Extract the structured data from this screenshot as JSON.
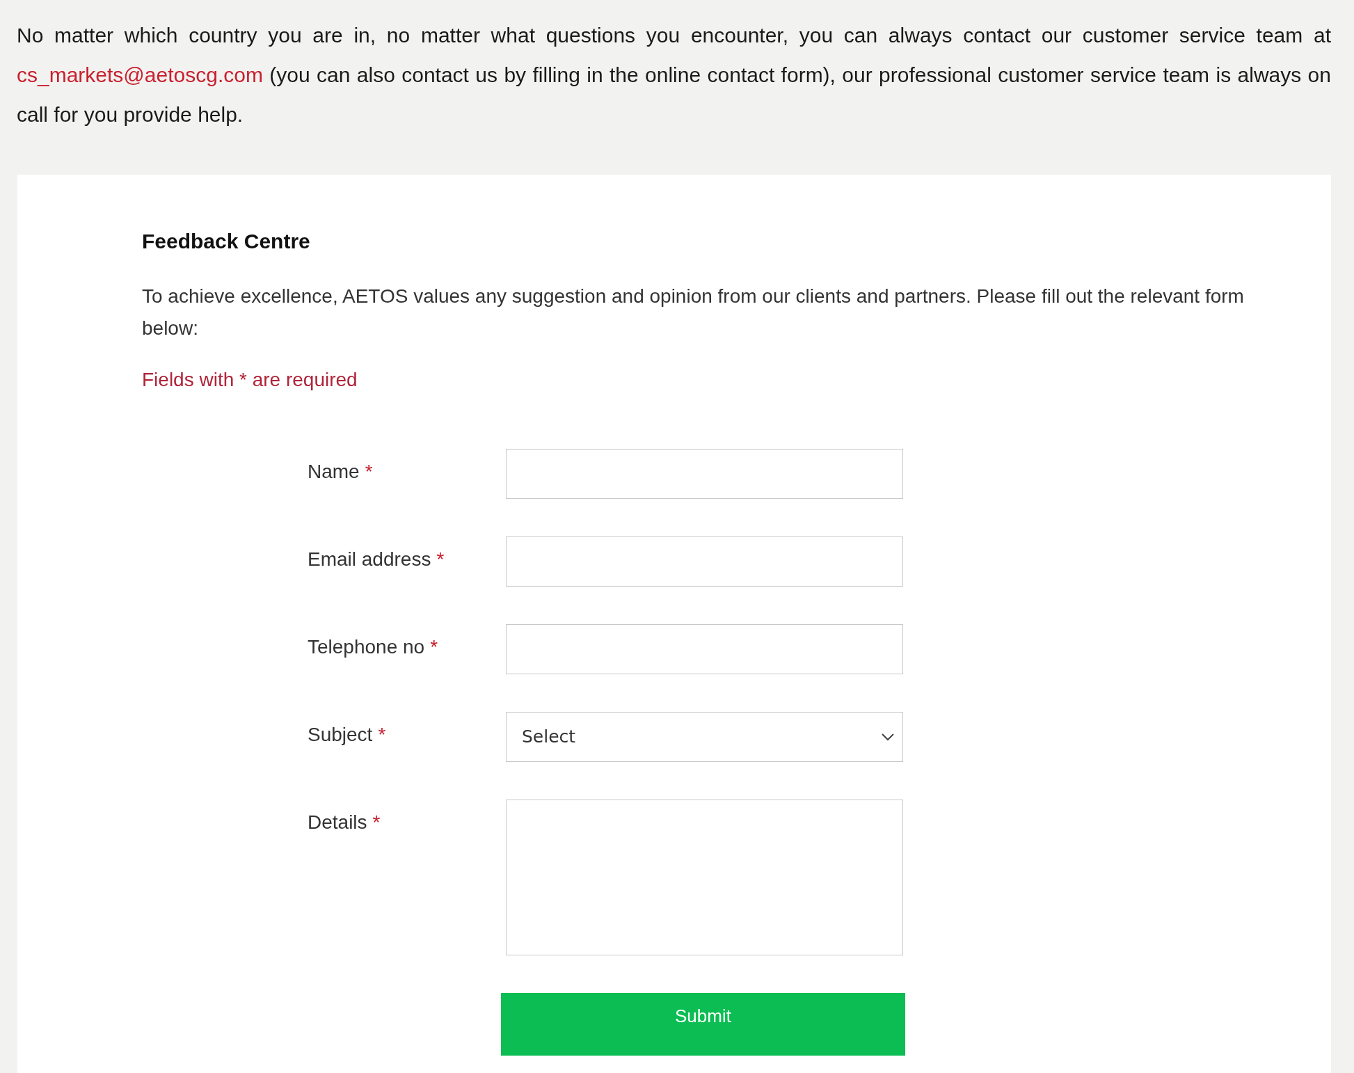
{
  "intro": {
    "text_before": "No matter which country you are in, no matter what questions you encounter, you can always contact our customer service team at ",
    "link": "cs_markets@aetoscg.com",
    "text_after": " (you can also contact us by filling in the online contact form), our professional customer service team is always on call for you provide help."
  },
  "form_card": {
    "title": "Feedback Centre",
    "description": "To achieve excellence, AETOS values any suggestion and opinion from our clients and partners. Please fill out the relevant form below:",
    "required_note": "Fields with * are required",
    "fields": [
      {
        "kind": "text",
        "label": "Name",
        "required_mark": "*"
      },
      {
        "kind": "text",
        "label": "Email address",
        "required_mark": "*"
      },
      {
        "kind": "text",
        "label": "Telephone no",
        "required_mark": "*"
      },
      {
        "kind": "select",
        "label": "Subject",
        "required_mark": "*",
        "value": "Select"
      },
      {
        "kind": "textarea",
        "label": "Details",
        "required_mark": "*"
      }
    ],
    "submit_button": "Submit"
  }
}
